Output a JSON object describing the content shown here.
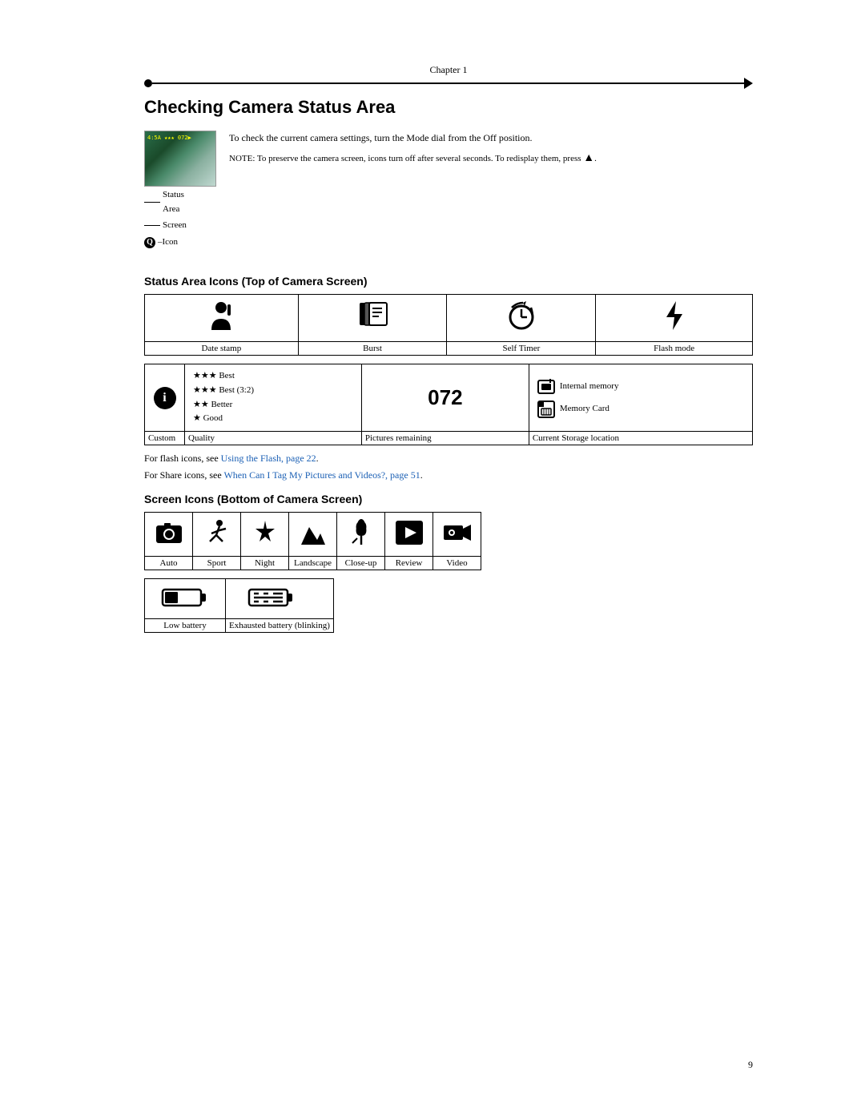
{
  "page": {
    "chapter_label": "Chapter 1",
    "title": "Checking Camera Status Area",
    "intro": {
      "status_area_label": "Status\nArea",
      "screen_icon_label": "Screen\nIcon",
      "q_icon_label": "Q-Icon",
      "description": "To check the current camera settings, turn the Mode dial from the Off position.",
      "note": "NOTE: To preserve the camera screen, icons turn off after several seconds. To redisplay them, press"
    },
    "section1": {
      "title": "Status Area Icons (Top of Camera Screen)"
    },
    "icons_row1": [
      {
        "label": "Date stamp"
      },
      {
        "label": "Burst"
      },
      {
        "label": "Self Timer"
      },
      {
        "label": "Flash mode"
      }
    ],
    "quality_section": {
      "info_icon": "ℹ",
      "stars": [
        "★★★  Best",
        "★★★  Best (3:2)",
        "★★    Better",
        "★      Good"
      ],
      "count": "072",
      "storage_internal": "Internal memory",
      "storage_card": "Memory Card"
    },
    "quality_labels": [
      "Custom",
      "Quality",
      "Pictures remaining",
      "Current Storage location"
    ],
    "notes": [
      {
        "text": "For flash icons, see ",
        "link": "Using the Flash, page 22",
        "rest": "."
      },
      {
        "text": "For Share icons, see ",
        "link": "When Can I Tag My Pictures and Videos?, page 51",
        "rest": "."
      }
    ],
    "section2": {
      "title": "Screen Icons (Bottom of Camera Screen)"
    },
    "screen_icons": [
      {
        "label": "Auto"
      },
      {
        "label": "Sport"
      },
      {
        "label": "Night"
      },
      {
        "label": "Landscape"
      },
      {
        "label": "Close-up"
      },
      {
        "label": "Review"
      },
      {
        "label": "Video"
      }
    ],
    "battery_icons": [
      {
        "label": "Low battery"
      },
      {
        "label": "Exhausted battery (blinking)"
      }
    ],
    "page_number": "9"
  }
}
